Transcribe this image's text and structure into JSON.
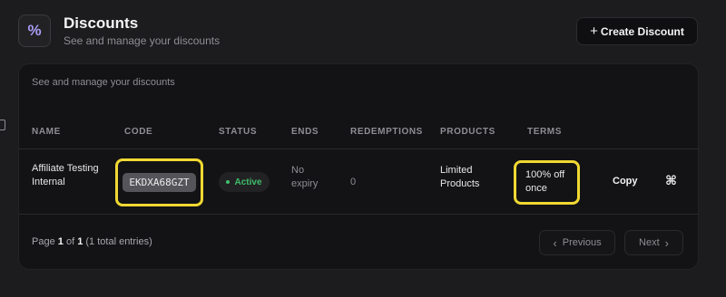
{
  "header": {
    "icon": "percent-icon",
    "title": "Discounts",
    "subtitle": "See and manage your discounts",
    "create_button": "Create Discount"
  },
  "card": {
    "description": "See and manage your discounts",
    "columns": [
      "NAME",
      "CODE",
      "STATUS",
      "ENDS",
      "REDEMPTIONS",
      "PRODUCTS",
      "TERMS"
    ],
    "rows": [
      {
        "name": "Affiliate Testing Internal",
        "code": "EKDXA68GZT",
        "status": "Active",
        "ends": "No expiry",
        "redemptions": "0",
        "products": "Limited Products",
        "terms": "100% off once",
        "copy_label": "Copy",
        "command_icon": "⌘"
      }
    ]
  },
  "pagination": {
    "prefix": "Page",
    "current": "1",
    "of": "of",
    "total_pages": "1",
    "entries": "(1 total entries)",
    "previous": "Previous",
    "next": "Next"
  },
  "colors": {
    "background": "#1c1c1e",
    "card": "#131315",
    "highlight": "#f0d832",
    "active": "#3fbf6a",
    "accent": "#a89cf2"
  }
}
